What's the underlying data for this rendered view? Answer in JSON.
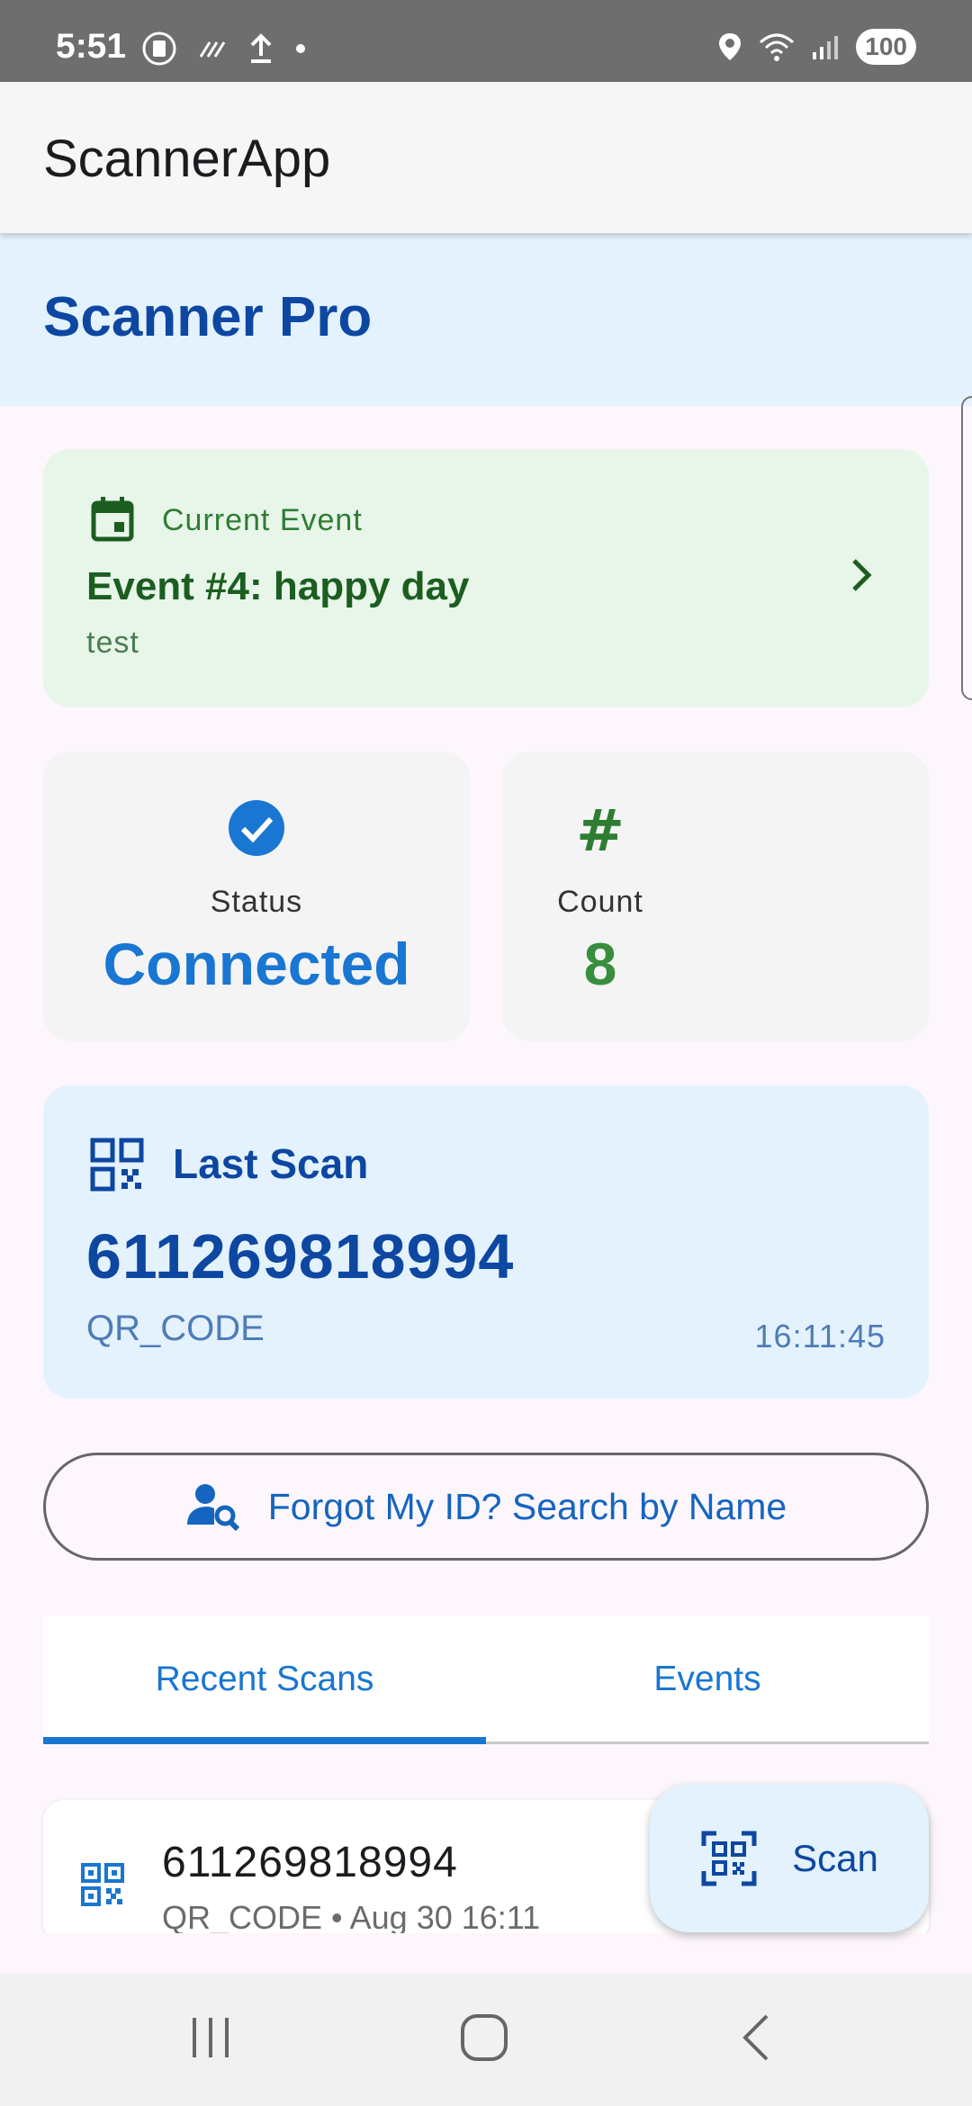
{
  "status_bar": {
    "time": "5:51",
    "battery": "100",
    "icons": [
      "sim-card-icon",
      "signal-slash-icon",
      "upload-icon",
      "dot-icon",
      "location-icon",
      "wifi-icon",
      "cell-signal-icon"
    ]
  },
  "app_bar": {
    "title": "ScannerApp"
  },
  "header": {
    "title": "Scanner Pro"
  },
  "event_card": {
    "label": "Current Event",
    "name": "Event #4: happy day",
    "subtitle": "test",
    "icon": "calendar-icon"
  },
  "status_card": {
    "label": "Status",
    "value": "Connected",
    "icon": "check-circle-icon"
  },
  "count_card": {
    "label": "Count",
    "value": "8",
    "icon_text": "#"
  },
  "last_scan": {
    "label": "Last Scan",
    "code": "611269818994",
    "type": "QR_CODE",
    "time": "16:11:45"
  },
  "forgot_button": {
    "label": "Forgot My ID? Search by Name"
  },
  "tabs": [
    {
      "label": "Recent Scans",
      "selected": true
    },
    {
      "label": "Events",
      "selected": false
    }
  ],
  "recent_scans": [
    {
      "code": "611269818994",
      "meta": "QR_CODE • Aug 30 16:11"
    }
  ],
  "fab": {
    "label": "Scan"
  },
  "colors": {
    "primary": "#1976d2",
    "primary_dark": "#0d47a1",
    "green": "#2e7d32",
    "light_blue": "#e3f2fd",
    "light_green": "#e8f5e9"
  }
}
